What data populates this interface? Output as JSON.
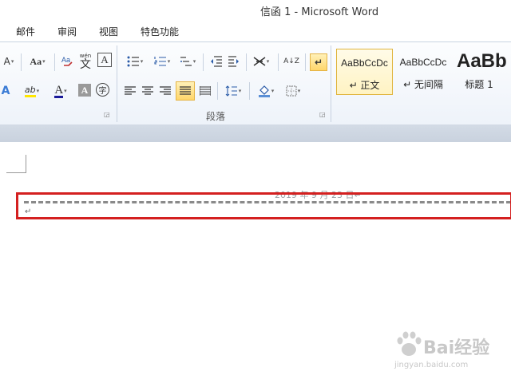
{
  "window": {
    "title": "信函 1  -  Microsoft Word"
  },
  "menu": {
    "items": [
      "邮件",
      "审阅",
      "视图",
      "特色功能"
    ]
  },
  "ribbon": {
    "font_group": {
      "font_size_btn": "A",
      "change_case_btn": "Aa",
      "phonetic_btn": "wén",
      "phonetic_char": "文",
      "char_border_btn": "A",
      "highlight_btn": "ab",
      "font_color_btn": "A",
      "char_shading_btn": "A",
      "enclose_char_btn": "字",
      "text_effect_btn": "A"
    },
    "paragraph_group": {
      "label": "段落",
      "sort_btn": "A↓Z",
      "show_marks_btn": "↵"
    },
    "styles_group": {
      "tiles": [
        {
          "sample": "AaBbCcDc",
          "name": "↵ 正文"
        },
        {
          "sample": "AaBbCcDc",
          "name": "↵ 无间隔"
        },
        {
          "sample": "AaBb",
          "name": "标题 1"
        }
      ]
    }
  },
  "document": {
    "date_line": "2019 年 9 月 23 日↵",
    "paragraph_mark": "↵"
  },
  "watermark": {
    "text": "Bai经验",
    "sub": "jingyan.baidu.com"
  }
}
